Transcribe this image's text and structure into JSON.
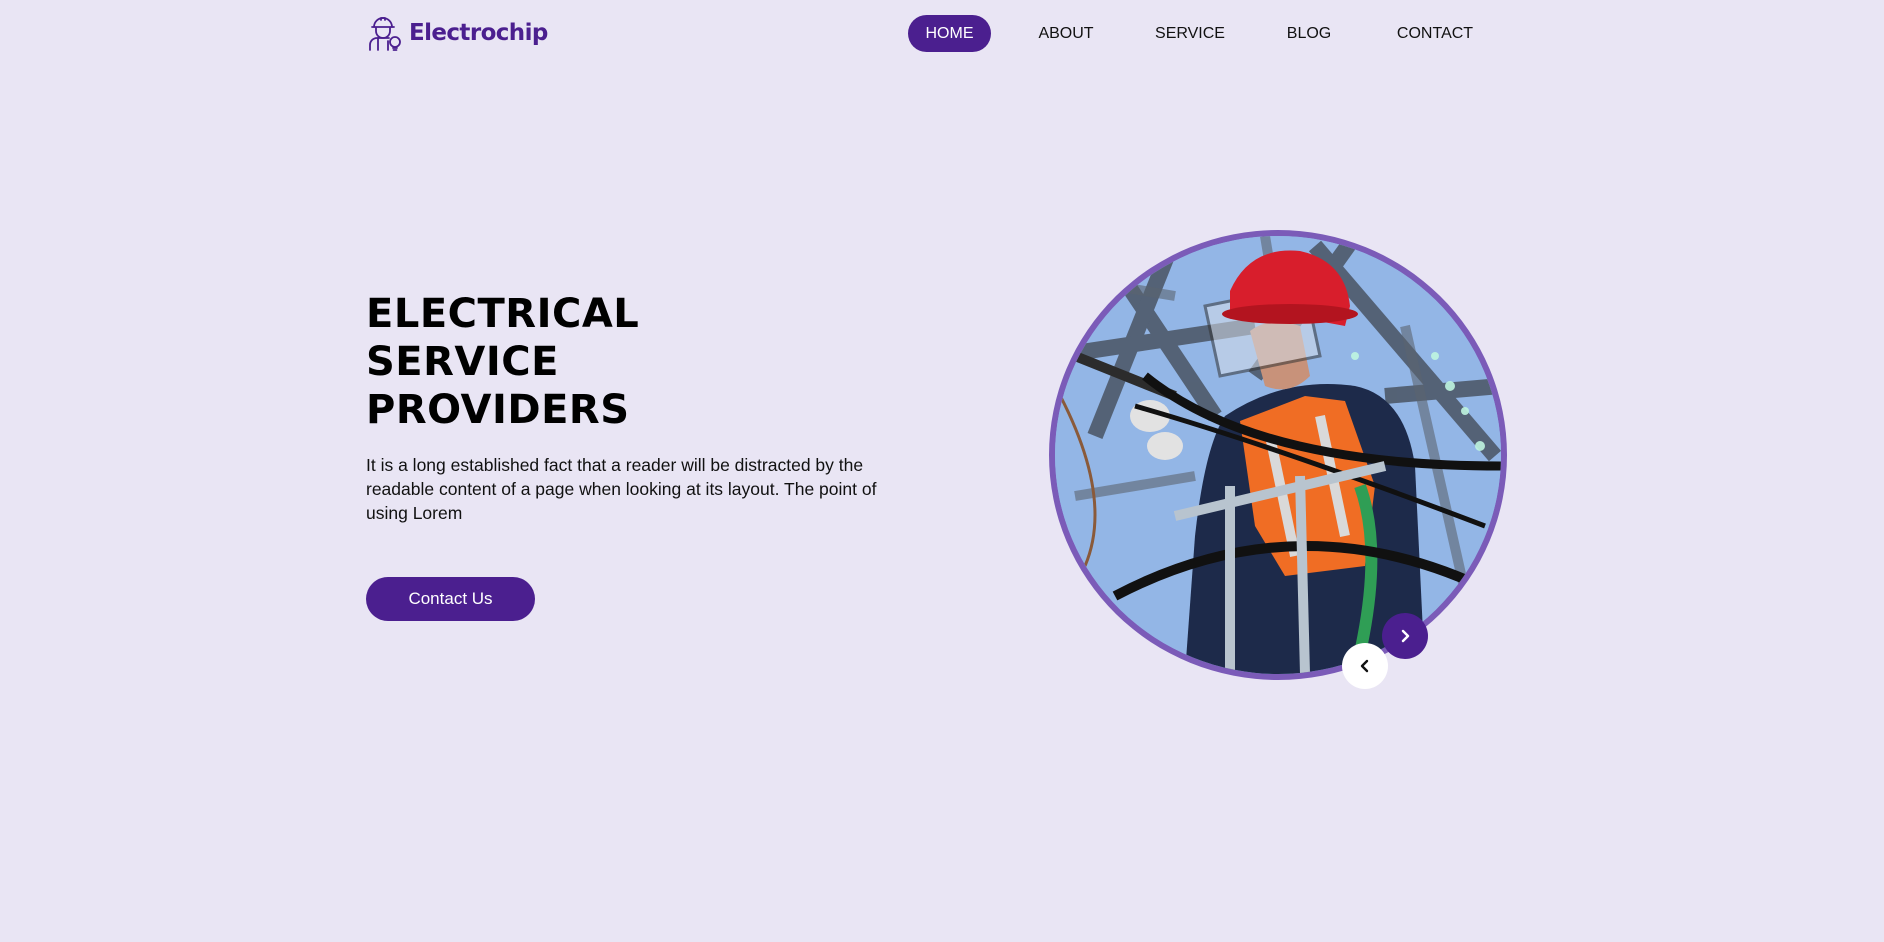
{
  "brand": {
    "name": "Electrochip",
    "logo_icon": "worker-with-lightbulb-icon",
    "color": "#4b1f8f"
  },
  "nav": {
    "items": [
      {
        "label": "HOME",
        "active": true
      },
      {
        "label": "ABOUT",
        "active": false
      },
      {
        "label": "SERVICE",
        "active": false
      },
      {
        "label": "BLOG",
        "active": false
      },
      {
        "label": "CONTACT",
        "active": false
      }
    ]
  },
  "hero": {
    "title_lines": [
      "ELECTRICAL",
      "SERVICE",
      "PROVIDERS"
    ],
    "description": "It is a long established fact that a reader will be distracted by the readable content of a page when looking at its layout. The point of using Lorem",
    "cta_label": "Contact Us",
    "image_icon": "electrician-photo",
    "prev_icon": "chevron-left-icon",
    "next_icon": "chevron-right-icon"
  },
  "colors": {
    "background": "#e9e5f4",
    "accent": "#4b1f8f",
    "ring": "#7b5bb8"
  }
}
